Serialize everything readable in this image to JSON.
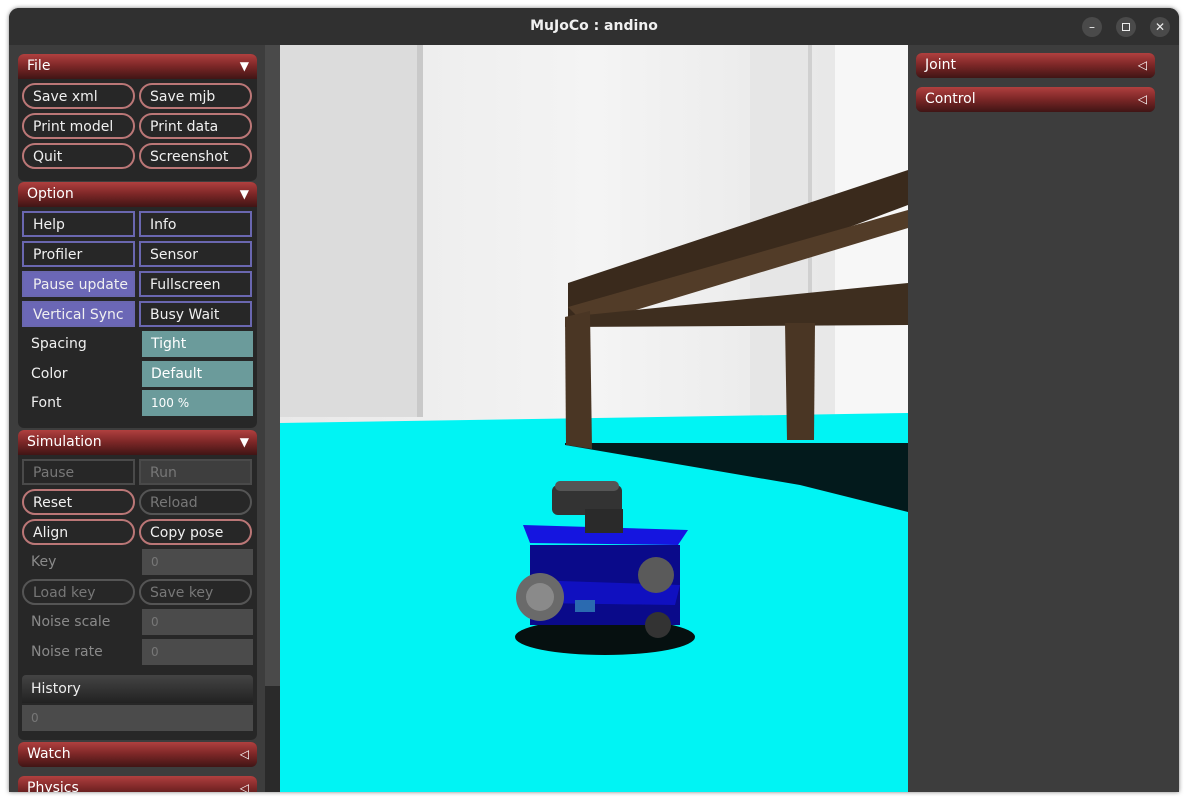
{
  "window": {
    "title": "MuJoCo : andino",
    "controls": {
      "minimize": "–",
      "close": "✕"
    }
  },
  "colors": {
    "section_header": "#802828",
    "checkbox_on": "#6b67b6",
    "select": "#6b9b9b",
    "floor": "#00f5f5",
    "robot": "#1010d0"
  },
  "left_panel": {
    "file": {
      "title": "File",
      "arrow": "▼",
      "buttons": [
        "Save xml",
        "Save mjb",
        "Print model",
        "Print data",
        "Quit",
        "Screenshot"
      ]
    },
    "option": {
      "title": "Option",
      "arrow": "▼",
      "checkboxes": [
        {
          "label": "Help",
          "checked": false
        },
        {
          "label": "Info",
          "checked": false
        },
        {
          "label": "Profiler",
          "checked": false
        },
        {
          "label": "Sensor",
          "checked": false
        },
        {
          "label": "Pause update",
          "checked": true
        },
        {
          "label": "Fullscreen",
          "checked": false
        },
        {
          "label": "Vertical Sync",
          "checked": true
        },
        {
          "label": "Busy Wait",
          "checked": false
        }
      ],
      "spacing": {
        "label": "Spacing",
        "value": "Tight"
      },
      "color": {
        "label": "Color",
        "value": "Default"
      },
      "font": {
        "label": "Font",
        "value": "100 %"
      }
    },
    "simulation": {
      "title": "Simulation",
      "arrow": "▼",
      "pause": "Pause",
      "run": "Run",
      "reset": "Reset",
      "reload": "Reload",
      "align": "Align",
      "copy_pose": "Copy pose",
      "key": {
        "label": "Key",
        "value": "0"
      },
      "load_key": "Load key",
      "save_key": "Save key",
      "noise_scale": {
        "label": "Noise scale",
        "value": "0"
      },
      "noise_rate": {
        "label": "Noise rate",
        "value": "0"
      },
      "history": {
        "label": "History",
        "value": "0"
      }
    },
    "watch": {
      "title": "Watch",
      "arrow": "◁"
    },
    "physics": {
      "title": "Physics",
      "arrow": "◁"
    }
  },
  "right_panel": {
    "joint": {
      "title": "Joint",
      "arrow": "◁"
    },
    "control": {
      "title": "Control",
      "arrow": "◁"
    }
  }
}
